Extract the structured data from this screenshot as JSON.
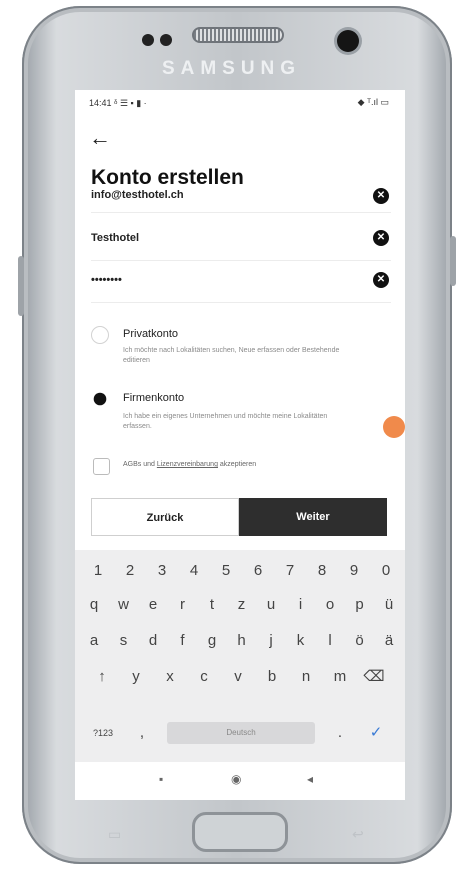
{
  "device": {
    "brand": "SAMSUNG"
  },
  "status_bar": {
    "time": "14:41",
    "left_icons": "ᵟ ☰ ▪ ▮ ·",
    "right_icons": "◆ ᵀ.ıl ▭"
  },
  "header": {
    "back_icon": "←",
    "title": "Konto erstellen"
  },
  "form": {
    "fields": [
      {
        "value": "info@testhotel.ch"
      },
      {
        "value": "Testhotel"
      },
      {
        "value": "••••••••"
      }
    ],
    "clear_icon": "✕"
  },
  "account_types": {
    "private": {
      "title": "Privatkonto",
      "desc": "Ich möchte nach Lokalitäten suchen, Neue erfassen oder Bestehende editieren",
      "selected": false
    },
    "business": {
      "title": "Firmenkonto",
      "desc": "Ich habe ein eigenes Unternehmen und möchte meine Lokalitäten erfassen.",
      "selected": true
    }
  },
  "agb": {
    "prefix": "AGBs und ",
    "link": "Lizenzvereinbarung",
    "suffix": " akzeptieren",
    "checked": false
  },
  "buttons": {
    "back": "Zurück",
    "next": "Weiter"
  },
  "keyboard": {
    "row_numbers": [
      "1",
      "2",
      "3",
      "4",
      "5",
      "6",
      "7",
      "8",
      "9",
      "0"
    ],
    "row1": [
      "q",
      "w",
      "e",
      "r",
      "t",
      "z",
      "u",
      "i",
      "o",
      "p",
      "ü"
    ],
    "row2": [
      "a",
      "s",
      "d",
      "f",
      "g",
      "h",
      "j",
      "k",
      "l",
      "ö",
      "ä"
    ],
    "row3": [
      "↑",
      "y",
      "x",
      "c",
      "v",
      "b",
      "n",
      "m",
      "⌫"
    ],
    "symbols": "?123",
    "comma": ",",
    "space_label": "Deutsch",
    "period": ".",
    "enter": "✓"
  },
  "nav_bar": {
    "recent": "▪",
    "home": "◉",
    "back": "◂"
  },
  "colors": {
    "accent": "#2e2e2e",
    "badge": "#f08a4b"
  }
}
